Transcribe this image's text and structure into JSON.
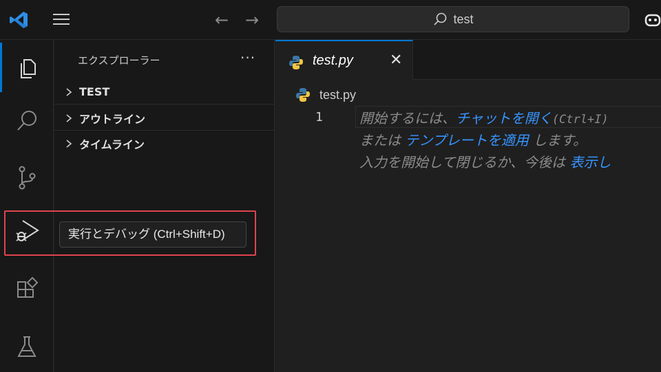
{
  "titlebar": {
    "search_text": "test",
    "nav_back": "←",
    "nav_forward": "→"
  },
  "sidebar": {
    "title": "エクスプローラー",
    "more": "···",
    "sections": [
      {
        "label": "TEST"
      },
      {
        "label": "アウトライン"
      },
      {
        "label": "タイムライン"
      }
    ]
  },
  "tooltip": {
    "text": "実行とデバッグ (Ctrl+Shift+D)"
  },
  "editor": {
    "tab_name": "test.py",
    "tab_close": "✕",
    "breadcrumb": "test.py",
    "line_number": "1",
    "hint_line1_a": "開始するには、",
    "hint_line1_link": "チャットを開く",
    "hint_line1_shortcut": "(Ctrl+I)",
    "hint_line2_a": "または ",
    "hint_line2_link": "テンプレートを適用",
    "hint_line2_b": " します。",
    "hint_line3_a": "入力を開始して閉じるか、今後は ",
    "hint_line3_link": "表示し"
  },
  "icons": {
    "activity": [
      "explorer-icon",
      "search-icon",
      "source-control-icon",
      "run-debug-icon",
      "extensions-icon",
      "testing-icon"
    ]
  },
  "colors": {
    "accent": "#0078d4",
    "highlight_border": "#e0444f",
    "link": "#3794ff"
  }
}
